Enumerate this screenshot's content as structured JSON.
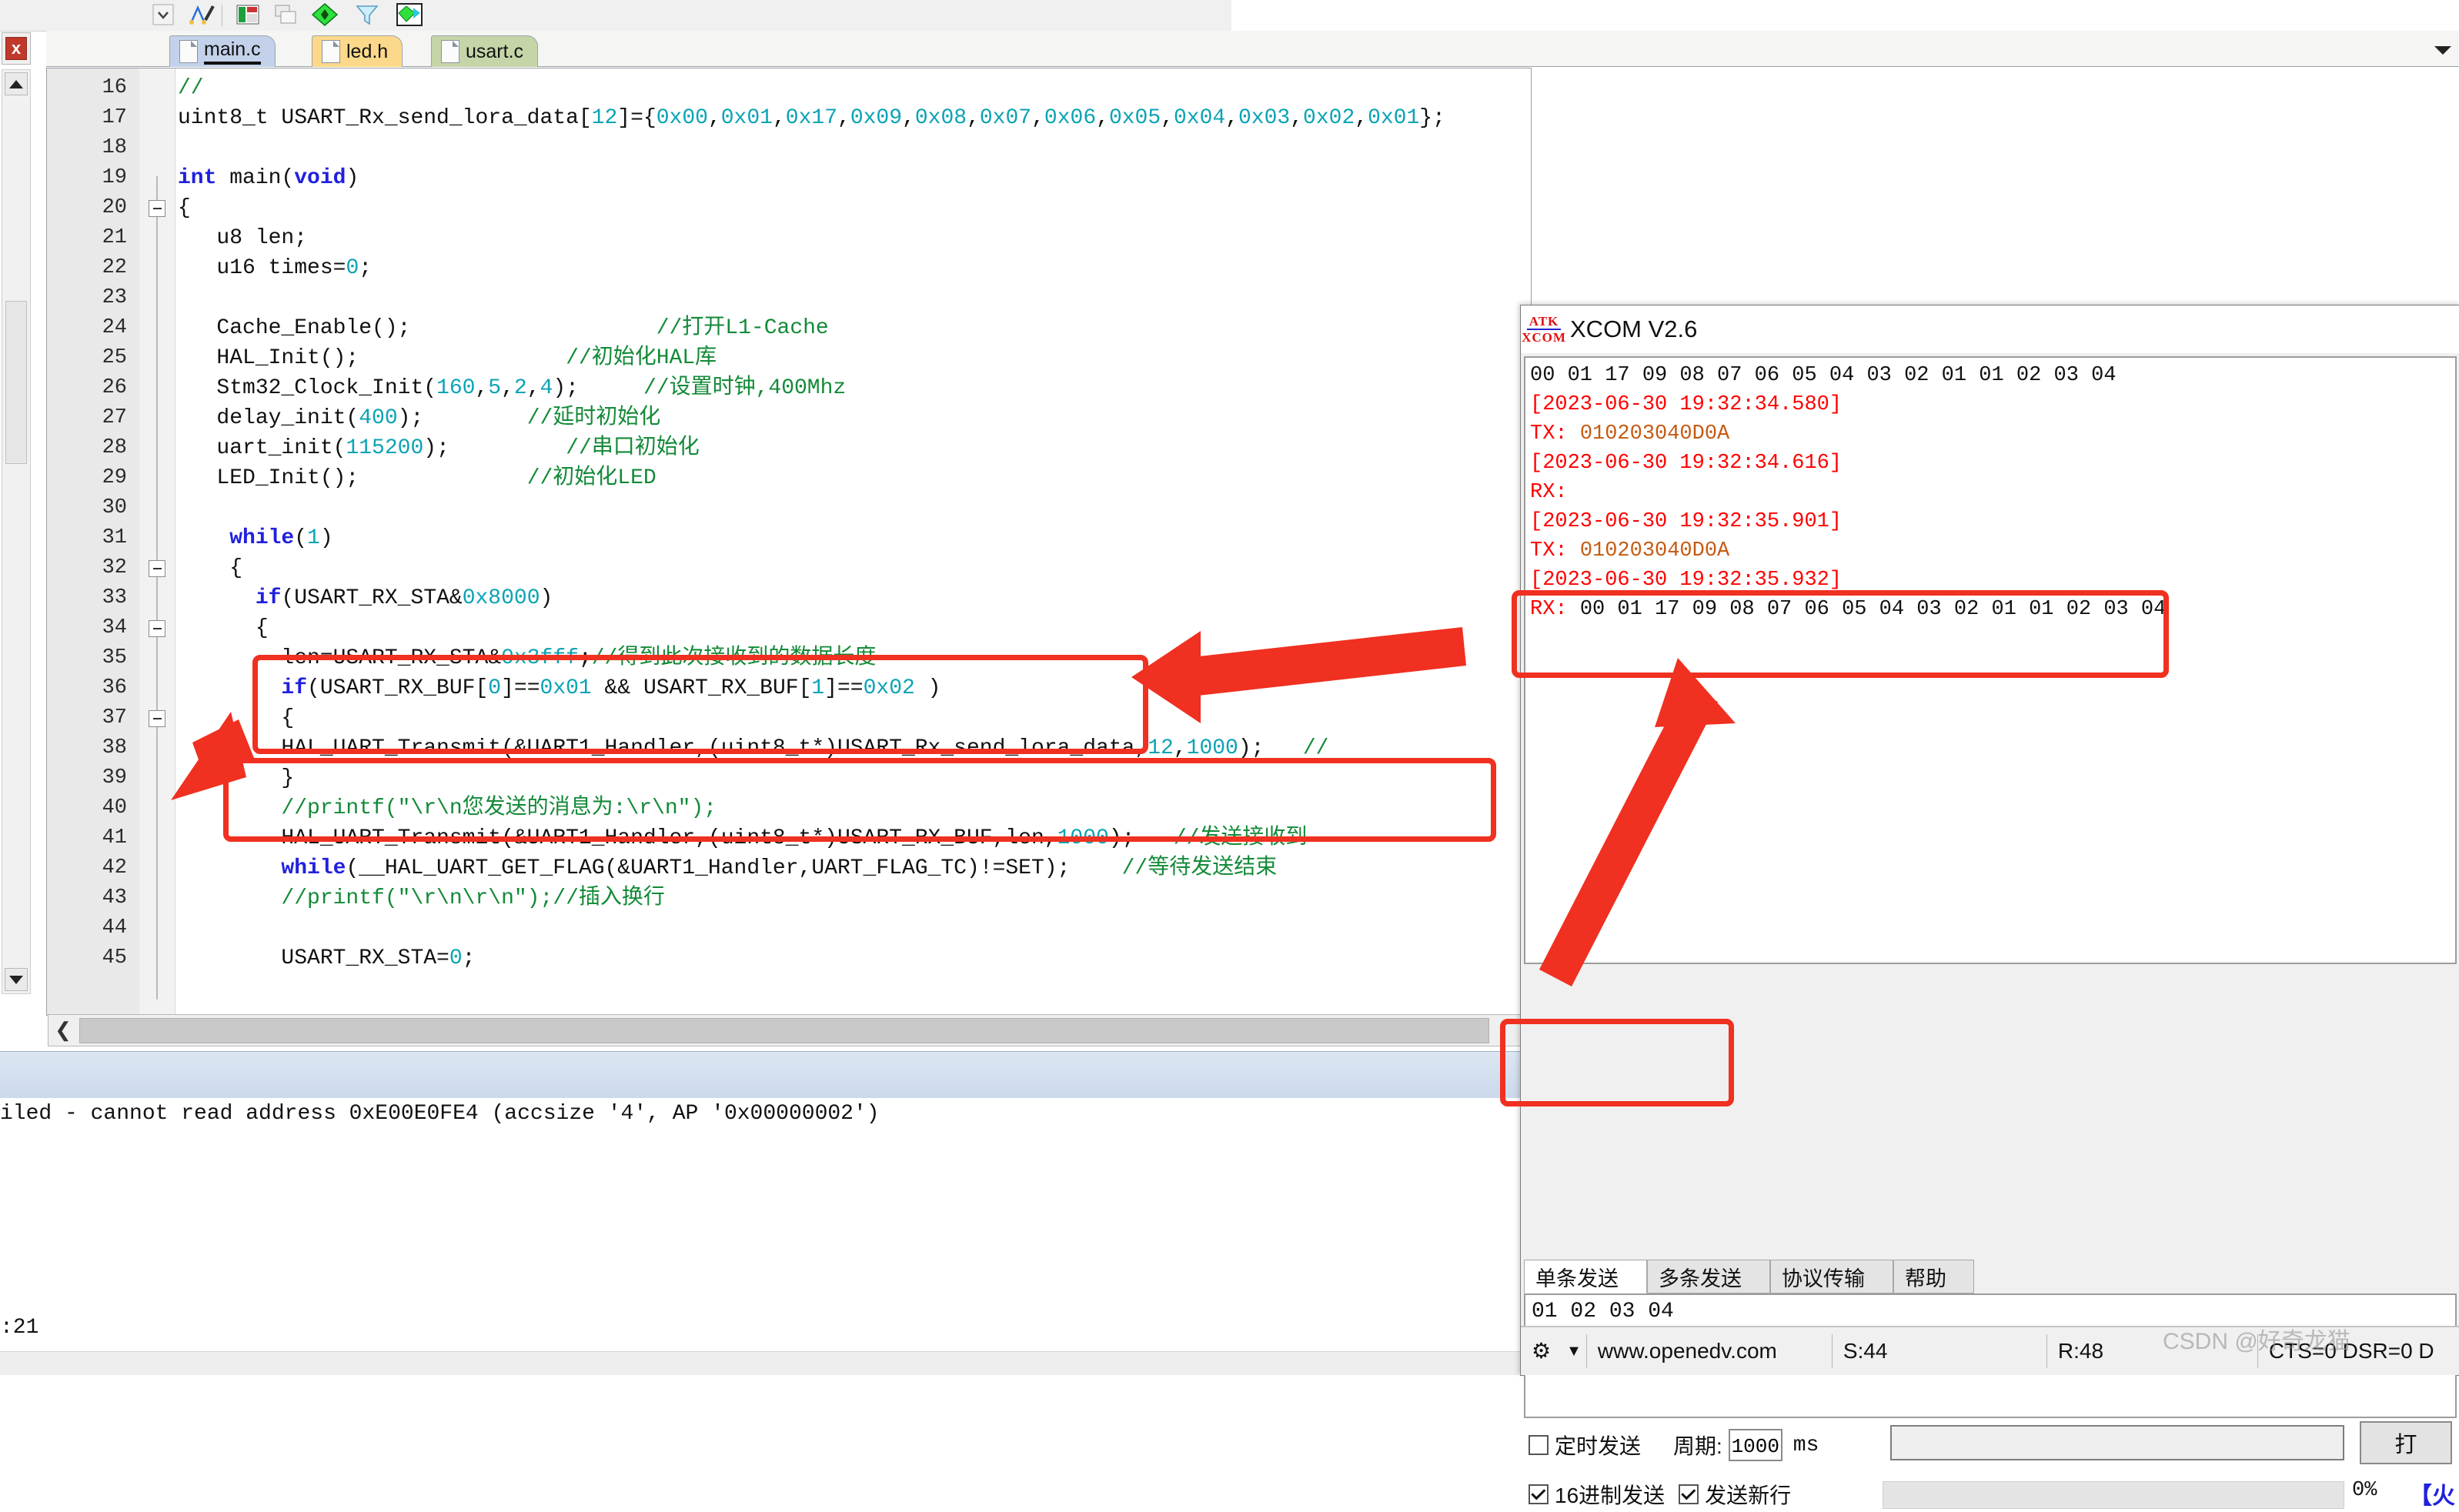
{
  "ide": {
    "toolbar_icons": [
      "dropdown-icon",
      "bookmark-icon",
      "window-layout-icon",
      "copy-icon",
      "green-diamond-icon",
      "funnel-icon",
      "target-diamond-icon"
    ],
    "close_label": "x",
    "tabs": [
      {
        "label": "main.c",
        "active": true
      },
      {
        "label": "led.h",
        "active": false
      },
      {
        "label": "usart.c",
        "active": false
      }
    ],
    "code_lines": [
      {
        "n": "16",
        "segs": [
          {
            "t": "//",
            "c": "cm"
          }
        ]
      },
      {
        "n": "17",
        "segs": [
          {
            "t": "uint8_t USART_Rx_send_lora_data[",
            "c": ""
          },
          {
            "t": "12",
            "c": "num"
          },
          {
            "t": "]={",
            "c": ""
          },
          {
            "t": "0x00",
            "c": "num"
          },
          {
            "t": ",",
            "c": ""
          },
          {
            "t": "0x01",
            "c": "num"
          },
          {
            "t": ",",
            "c": ""
          },
          {
            "t": "0x17",
            "c": "num"
          },
          {
            "t": ",",
            "c": ""
          },
          {
            "t": "0x09",
            "c": "num"
          },
          {
            "t": ",",
            "c": ""
          },
          {
            "t": "0x08",
            "c": "num"
          },
          {
            "t": ",",
            "c": ""
          },
          {
            "t": "0x07",
            "c": "num"
          },
          {
            "t": ",",
            "c": ""
          },
          {
            "t": "0x06",
            "c": "num"
          },
          {
            "t": ",",
            "c": ""
          },
          {
            "t": "0x05",
            "c": "num"
          },
          {
            "t": ",",
            "c": ""
          },
          {
            "t": "0x04",
            "c": "num"
          },
          {
            "t": ",",
            "c": ""
          },
          {
            "t": "0x03",
            "c": "num"
          },
          {
            "t": ",",
            "c": ""
          },
          {
            "t": "0x02",
            "c": "num"
          },
          {
            "t": ",",
            "c": ""
          },
          {
            "t": "0x01",
            "c": "num"
          },
          {
            "t": "};",
            "c": ""
          }
        ]
      },
      {
        "n": "18",
        "segs": []
      },
      {
        "n": "19",
        "segs": [
          {
            "t": "int ",
            "c": "kw"
          },
          {
            "t": "main(",
            "c": ""
          },
          {
            "t": "void",
            "c": "kw"
          },
          {
            "t": ")",
            "c": ""
          }
        ]
      },
      {
        "n": "20",
        "segs": [
          {
            "t": "{",
            "c": ""
          }
        ],
        "fold": true
      },
      {
        "n": "21",
        "segs": [
          {
            "t": "   u8 len;",
            "c": ""
          }
        ]
      },
      {
        "n": "22",
        "segs": [
          {
            "t": "   u16 times=",
            "c": ""
          },
          {
            "t": "0",
            "c": "num"
          },
          {
            "t": ";",
            "c": ""
          }
        ]
      },
      {
        "n": "23",
        "segs": []
      },
      {
        "n": "24",
        "segs": [
          {
            "t": "   Cache_Enable();                   ",
            "c": ""
          },
          {
            "t": "//打开L1-Cache",
            "c": "cm"
          }
        ]
      },
      {
        "n": "25",
        "segs": [
          {
            "t": "   HAL_Init();                ",
            "c": ""
          },
          {
            "t": "//初始化HAL库",
            "c": "cm"
          }
        ]
      },
      {
        "n": "26",
        "segs": [
          {
            "t": "   Stm32_Clock_Init(",
            "c": ""
          },
          {
            "t": "160",
            "c": "num"
          },
          {
            "t": ",",
            "c": ""
          },
          {
            "t": "5",
            "c": "num"
          },
          {
            "t": ",",
            "c": ""
          },
          {
            "t": "2",
            "c": "num"
          },
          {
            "t": ",",
            "c": ""
          },
          {
            "t": "4",
            "c": "num"
          },
          {
            "t": ");     ",
            "c": ""
          },
          {
            "t": "//设置时钟,400Mhz",
            "c": "cm"
          }
        ]
      },
      {
        "n": "27",
        "segs": [
          {
            "t": "   delay_init(",
            "c": ""
          },
          {
            "t": "400",
            "c": "num"
          },
          {
            "t": ");        ",
            "c": ""
          },
          {
            "t": "//延时初始化",
            "c": "cm"
          }
        ]
      },
      {
        "n": "28",
        "segs": [
          {
            "t": "   uart_init(",
            "c": ""
          },
          {
            "t": "115200",
            "c": "num"
          },
          {
            "t": ");         ",
            "c": ""
          },
          {
            "t": "//串口初始化",
            "c": "cm"
          }
        ]
      },
      {
        "n": "29",
        "segs": [
          {
            "t": "   LED_Init();             ",
            "c": ""
          },
          {
            "t": "//初始化LED",
            "c": "cm"
          }
        ]
      },
      {
        "n": "30",
        "segs": []
      },
      {
        "n": "31",
        "segs": [
          {
            "t": "    ",
            "c": ""
          },
          {
            "t": "while",
            "c": "kw"
          },
          {
            "t": "(",
            "c": ""
          },
          {
            "t": "1",
            "c": "num"
          },
          {
            "t": ")",
            "c": ""
          }
        ]
      },
      {
        "n": "32",
        "segs": [
          {
            "t": "    {",
            "c": ""
          }
        ],
        "fold": true
      },
      {
        "n": "33",
        "segs": [
          {
            "t": "      ",
            "c": ""
          },
          {
            "t": "if",
            "c": "kw"
          },
          {
            "t": "(USART_RX_STA&",
            "c": ""
          },
          {
            "t": "0x8000",
            "c": "num"
          },
          {
            "t": ")",
            "c": ""
          }
        ]
      },
      {
        "n": "34",
        "segs": [
          {
            "t": "      {",
            "c": ""
          }
        ],
        "fold": true
      },
      {
        "n": "35",
        "segs": [
          {
            "t": "        len=USART_RX_STA&",
            "c": ""
          },
          {
            "t": "0x3fff",
            "c": "num"
          },
          {
            "t": ";",
            "c": ""
          },
          {
            "t": "//得到此次接收到的数据长度",
            "c": "cm"
          }
        ]
      },
      {
        "n": "36",
        "segs": [
          {
            "t": "        ",
            "c": ""
          },
          {
            "t": "if",
            "c": "kw"
          },
          {
            "t": "(USART_RX_BUF[",
            "c": ""
          },
          {
            "t": "0",
            "c": "num"
          },
          {
            "t": "]==",
            "c": ""
          },
          {
            "t": "0x01",
            "c": "num"
          },
          {
            "t": " && USART_RX_BUF[",
            "c": ""
          },
          {
            "t": "1",
            "c": "num"
          },
          {
            "t": "]==",
            "c": ""
          },
          {
            "t": "0x02",
            "c": "num"
          },
          {
            "t": " )",
            "c": ""
          }
        ]
      },
      {
        "n": "37",
        "segs": [
          {
            "t": "        {",
            "c": ""
          }
        ],
        "fold": true
      },
      {
        "n": "38",
        "segs": [
          {
            "t": "        HAL_UART_Transmit(&UART1_Handler,(uint8_t*)USART_Rx_send_lora_data,",
            "c": ""
          },
          {
            "t": "12",
            "c": "num"
          },
          {
            "t": ",",
            "c": ""
          },
          {
            "t": "1000",
            "c": "num"
          },
          {
            "t": ");   ",
            "c": ""
          },
          {
            "t": "//",
            "c": "cm"
          }
        ]
      },
      {
        "n": "39",
        "segs": [
          {
            "t": "        }",
            "c": ""
          }
        ]
      },
      {
        "n": "40",
        "segs": [
          {
            "t": "        ",
            "c": ""
          },
          {
            "t": "//printf(\"\\r\\n您发送的消息为:\\r\\n\");",
            "c": "cm"
          }
        ]
      },
      {
        "n": "41",
        "segs": [
          {
            "t": "        HAL_UART_Transmit(&UART1_Handler,(uint8_t*)USART_RX_BUF,len,",
            "c": ""
          },
          {
            "t": "1000",
            "c": "num"
          },
          {
            "t": ");   ",
            "c": ""
          },
          {
            "t": "//发送接收到",
            "c": "cm"
          }
        ]
      },
      {
        "n": "42",
        "segs": [
          {
            "t": "        ",
            "c": ""
          },
          {
            "t": "while",
            "c": "kw"
          },
          {
            "t": "(__HAL_UART_GET_FLAG(&UART1_Handler,UART_FLAG_TC)!=SET);    ",
            "c": ""
          },
          {
            "t": "//等待发送结束",
            "c": "cm"
          }
        ]
      },
      {
        "n": "43",
        "segs": [
          {
            "t": "        ",
            "c": ""
          },
          {
            "t": "//printf(\"\\r\\n\\r\\n\");//插入换行",
            "c": "cm"
          }
        ]
      },
      {
        "n": "44",
        "segs": []
      },
      {
        "n": "45",
        "segs": [
          {
            "t": "        USART_RX_STA=",
            "c": ""
          },
          {
            "t": "0",
            "c": "num"
          },
          {
            "t": ";",
            "c": ""
          }
        ]
      }
    ],
    "build_output": "iled - cannot read address 0xE00E0FE4 (accsize '4', AP '0x00000002')",
    "status_line": ":21"
  },
  "xcom": {
    "logo_top": "ATK",
    "logo_bottom": "XCOM",
    "title": "XCOM V2.6",
    "log": [
      {
        "text": "00 01 17 09 08 07 06 05 04 03 02 01 01 02 03 04",
        "color": "lg-black"
      },
      {
        "text": "[2023-06-30 19:32:34.580]",
        "color": "lg-red"
      },
      {
        "text": "TX: 010203040D0A",
        "color": "lg-orange",
        "prefix": "TX: ",
        "prefix_color": "lg-red"
      },
      {
        "text": "[2023-06-30 19:32:34.616]",
        "color": "lg-red"
      },
      {
        "text": "RX:",
        "color": "lg-red"
      },
      {
        "text": "[2023-06-30 19:32:35.901]",
        "color": "lg-red"
      },
      {
        "text": "TX: 010203040D0A",
        "color": "lg-orange",
        "prefix": "TX: ",
        "prefix_color": "lg-red"
      },
      {
        "text": "[2023-06-30 19:32:35.932]",
        "color": "lg-red"
      },
      {
        "text": "RX: 00 01 17 09 08 07 06 05 04 03 02 01 01 02 03 04",
        "color": "lg-black",
        "prefix": "RX: ",
        "prefix_color": "lg-red"
      }
    ],
    "tabs": [
      {
        "label": "单条发送",
        "active": true
      },
      {
        "label": "多条发送",
        "active": false
      },
      {
        "label": "协议传输",
        "active": false
      },
      {
        "label": "帮助",
        "active": false
      }
    ],
    "send_value": "01 02 03 04",
    "controls": {
      "timed_send_label": "定时发送",
      "timed_send_checked": false,
      "period_label": "周期:",
      "period_value": "1000",
      "period_unit": "ms",
      "hex_send_label": "16进制发送",
      "hex_send_checked": true,
      "newline_send_label": "发送新行",
      "newline_send_checked": true,
      "progress_text": "0%",
      "open_button_label": "打",
      "flame_label": "【火"
    },
    "status": {
      "gear_icon": "gear-icon",
      "dropdown_icon": "chevron-down-icon",
      "site": "www.openedv.com",
      "sent": "S:44",
      "received": "R:48",
      "flow": "CTS=0 DSR=0 D"
    }
  },
  "annotations": {
    "watermark": "CSDN @好奇龙猫",
    "accent_color": "#f03020"
  }
}
